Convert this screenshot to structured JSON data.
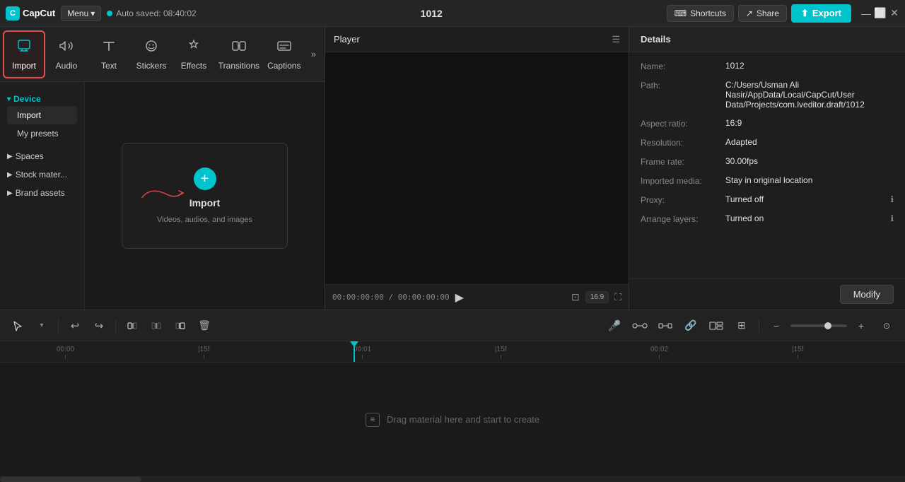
{
  "topbar": {
    "logo": "CapCut",
    "menu": "Menu",
    "autosave": "Auto saved: 08:40:02",
    "project_name": "1012",
    "shortcuts": "Shortcuts",
    "share": "Share",
    "export": "Export"
  },
  "tabs": [
    {
      "id": "import",
      "label": "Import",
      "icon": "⬇",
      "active": true
    },
    {
      "id": "audio",
      "label": "Audio",
      "icon": "♪",
      "active": false
    },
    {
      "id": "text",
      "label": "Text",
      "icon": "T",
      "active": false
    },
    {
      "id": "stickers",
      "label": "Stickers",
      "icon": "☻",
      "active": false
    },
    {
      "id": "effects",
      "label": "Effects",
      "icon": "✦",
      "active": false
    },
    {
      "id": "transitions",
      "label": "Transitions",
      "icon": "⊡",
      "active": false
    },
    {
      "id": "captions",
      "label": "Captions",
      "icon": "≡",
      "active": false
    }
  ],
  "sidebar": {
    "device": {
      "label": "Device",
      "items": [
        "Import",
        "My presets"
      ]
    },
    "spaces": {
      "label": "Spaces"
    },
    "stock_material": {
      "label": "Stock mater..."
    },
    "brand_assets": {
      "label": "Brand assets"
    }
  },
  "import_zone": {
    "label": "Import",
    "sublabel": "Videos, audios, and images"
  },
  "player": {
    "title": "Player",
    "time_current": "00:00:00:00",
    "time_total": "00:00:00:00",
    "aspect_ratio": "16:9"
  },
  "details": {
    "title": "Details",
    "fields": [
      {
        "label": "Name:",
        "value": "1012"
      },
      {
        "label": "Path:",
        "value": "C:/Users/Usman Ali Nasir/AppData/Local/CapCut/User Data/Projects/com.lveditor.draft/1012"
      },
      {
        "label": "Aspect ratio:",
        "value": "16:9"
      },
      {
        "label": "Resolution:",
        "value": "Adapted"
      },
      {
        "label": "Frame rate:",
        "value": "30.00fps"
      },
      {
        "label": "Imported media:",
        "value": "Stay in original location"
      },
      {
        "label": "Proxy:",
        "value": "Turned off"
      },
      {
        "label": "Arrange layers:",
        "value": "Turned on"
      }
    ],
    "modify_btn": "Modify"
  },
  "timeline": {
    "drop_hint": "Drag material here and start to create",
    "ruler_marks": [
      "00:00",
      "|15f",
      "00:01",
      "|15f",
      "00:02",
      "|15f"
    ],
    "ruler_positions": [
      0,
      200,
      420,
      620,
      840,
      1040
    ]
  }
}
